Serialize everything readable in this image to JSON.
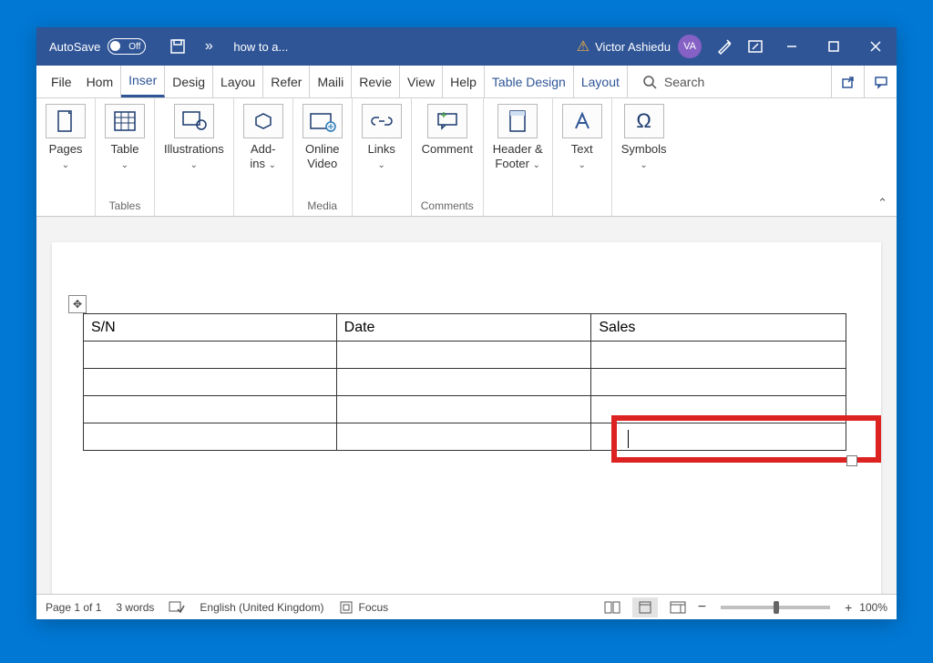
{
  "titlebar": {
    "autosave_label": "AutoSave",
    "autosave_state": "Off",
    "doc_title": "how to a...",
    "user_name": "Victor Ashiedu",
    "user_initials": "VA"
  },
  "tabs": {
    "file": "File",
    "home": "Hom",
    "insert": "Inser",
    "design": "Desig",
    "layout": "Layou",
    "references": "Refer",
    "mailings": "Maili",
    "review": "Revie",
    "view": "View",
    "help": "Help",
    "table_design": "Table Design",
    "table_layout": "Layout",
    "search": "Search"
  },
  "ribbon": {
    "pages": "Pages",
    "table": "Table",
    "illustrations": "Illustrations",
    "addins_l1": "Add-",
    "addins_l2": "ins",
    "online_l1": "Online",
    "online_l2": "Video",
    "links": "Links",
    "comment": "Comment",
    "headerfooter_l1": "Header &",
    "headerfooter_l2": "Footer",
    "text": "Text",
    "symbols": "Symbols",
    "group_tables": "Tables",
    "group_media": "Media",
    "group_comments": "Comments"
  },
  "table": {
    "headers": [
      "S/N",
      "Date",
      "Sales"
    ],
    "rows": 5
  },
  "status": {
    "page": "Page 1 of 1",
    "words": "3 words",
    "language": "English (United Kingdom)",
    "focus": "Focus",
    "zoom": "100%",
    "minus": "−",
    "plus": "+"
  }
}
